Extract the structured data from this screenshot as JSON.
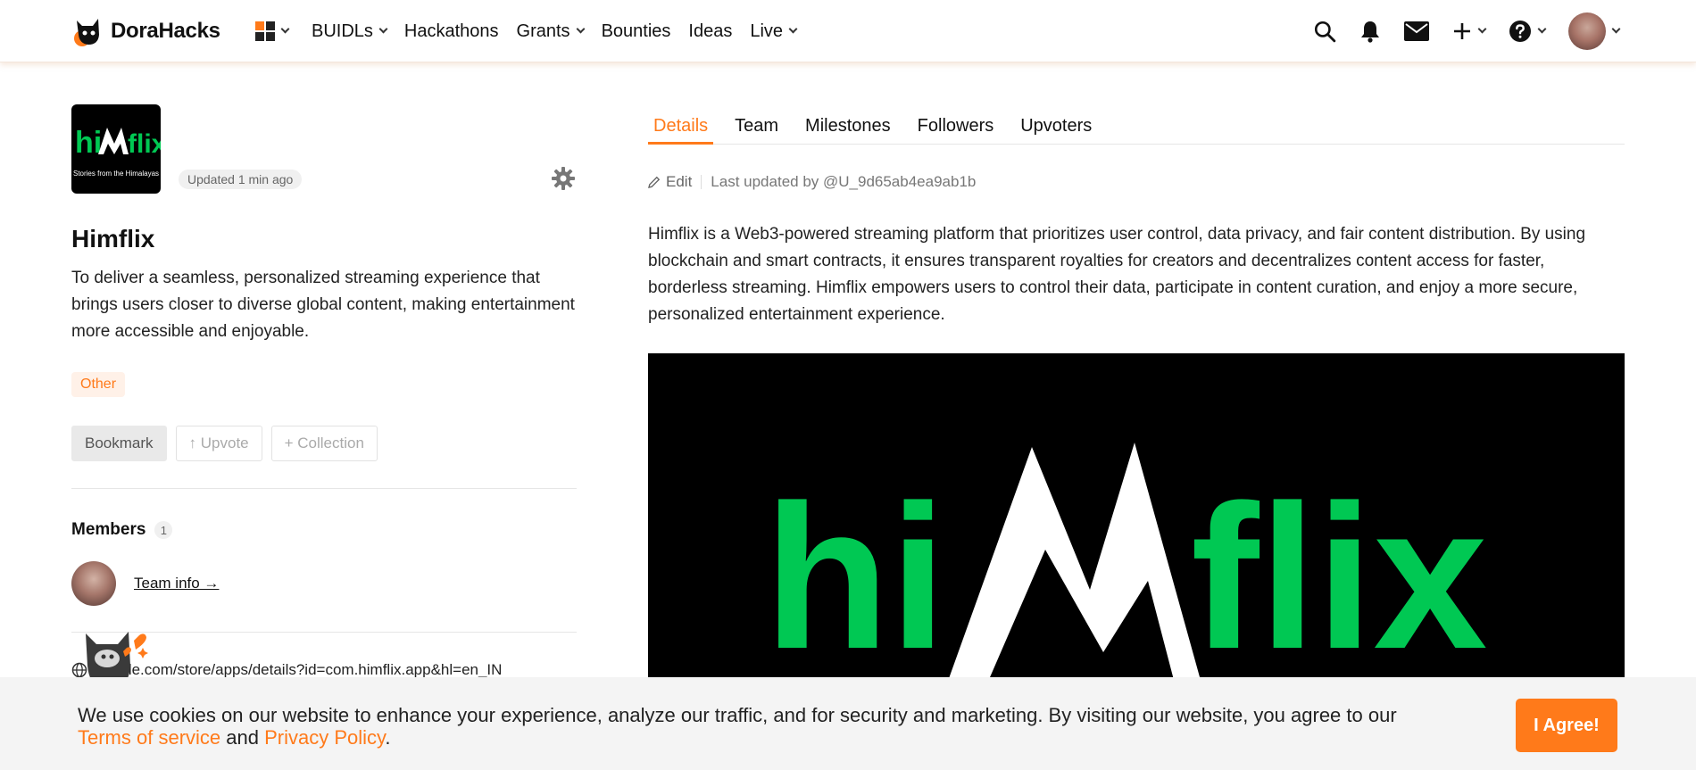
{
  "header": {
    "brand": "DoraHacks",
    "nav": [
      {
        "label": "BUIDLs",
        "has_dropdown": true
      },
      {
        "label": "Hackathons",
        "has_dropdown": false
      },
      {
        "label": "Grants",
        "has_dropdown": true
      },
      {
        "label": "Bounties",
        "has_dropdown": false
      },
      {
        "label": "Ideas",
        "has_dropdown": false
      },
      {
        "label": "Live",
        "has_dropdown": true
      }
    ],
    "icons": [
      "grid-icon",
      "search-icon",
      "bell-icon",
      "mail-icon",
      "plus-icon",
      "help-icon",
      "avatar"
    ]
  },
  "project": {
    "logo_text": "himflix",
    "logo_tagline": "Stories from the Himalayas",
    "updated": "Updated 1 min ago",
    "name": "Himflix",
    "summary": "To deliver a seamless, personalized streaming experience that brings users closer to diverse global content, making entertainment more accessible and enjoyable.",
    "tag": "Other",
    "buttons": {
      "bookmark": "Bookmark",
      "upvote": "↑ Upvote",
      "collection": "+ Collection"
    },
    "members_title": "Members",
    "members_count": "1",
    "team_info": "Team info →",
    "link": "google.com/store/apps/details?id=com.himflix.app&hl=en_IN"
  },
  "tabs": [
    {
      "label": "Details",
      "active": true
    },
    {
      "label": "Team",
      "active": false
    },
    {
      "label": "Milestones",
      "active": false
    },
    {
      "label": "Followers",
      "active": false
    },
    {
      "label": "Upvoters",
      "active": false
    }
  ],
  "details": {
    "edit_label": "Edit",
    "last_updated": "Last updated by @U_9d65ab4ea9ab1b",
    "body": "Himflix is a Web3-powered streaming platform that prioritizes user control, data privacy, and fair content distribution. By using blockchain and smart contracts, it ensures transparent royalties for creators and decentralizes content access for faster, borderless streaming. Himflix empowers users to control their data, participate in content curation, and enjoy a more secure, personalized entertainment experience.",
    "hero_text": "himflix"
  },
  "cookie": {
    "text_before": "We use cookies on our website to enhance your experience, analyze our traffic, and for security and marketing. By visiting our website, you agree to our ",
    "terms": "Terms of service",
    "and": " and ",
    "privacy": "Privacy Policy",
    "period": ".",
    "agree": "I Agree!"
  },
  "colors": {
    "accent": "#ff7a1a",
    "logo_green": "#00c853"
  }
}
